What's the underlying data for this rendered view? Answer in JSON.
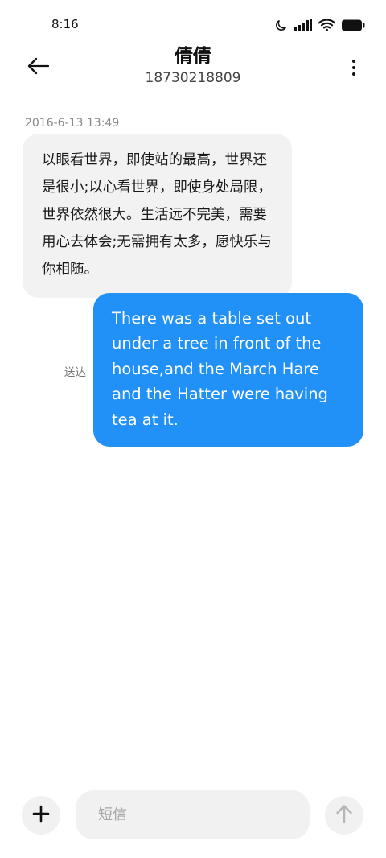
{
  "status_bar": {
    "time": "8:16",
    "icons": [
      "moon-icon",
      "cellular-signal-icon",
      "wifi-icon",
      "battery-icon"
    ]
  },
  "header": {
    "back_icon": "arrow-left-icon",
    "contact_name": "倩倩",
    "contact_number": "18730218809",
    "more_icon": "more-vertical-icon"
  },
  "conversation": {
    "timestamp": "2016-6-13 13:49",
    "incoming_message": "以眼看世界，即使站的最高，世界还是很小;以心看世界，即使身处局限，世界依然很大。生活远不完美，需要用心去体会;无需拥有太多，愿快乐与你相随。",
    "outgoing_message": "There was a table set out under a tree in front of the house,and the March Hare and the Hatter were having tea at it.",
    "delivery_status": "送达"
  },
  "composer": {
    "add_icon": "plus-icon",
    "placeholder": "短信",
    "value": "",
    "send_icon": "arrow-up-icon"
  },
  "colors": {
    "outgoing_bubble": "#2291f7",
    "incoming_bubble": "#f2f2f2",
    "button_background": "#f1f1f1"
  }
}
